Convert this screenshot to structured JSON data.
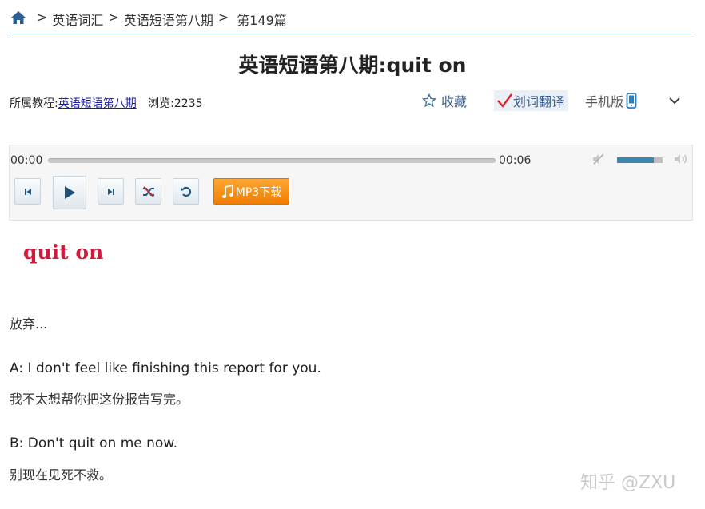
{
  "breadcrumb": {
    "items": [
      "英语词汇",
      "英语短语第八期",
      "第149篇"
    ],
    "separator": ">"
  },
  "title": "英语短语第八期:quit on",
  "meta": {
    "course_label": "所属教程:",
    "course_link": "英语短语第八期",
    "views_label": "浏览:",
    "views_count": "2235"
  },
  "toolbar": {
    "favorite": "收藏",
    "translate": "划词翻译",
    "mobile": "手机版"
  },
  "player": {
    "current_time": "00:00",
    "total_time": "00:06",
    "progress": 0,
    "volume": 0.8,
    "mp3_label": "MP3下载"
  },
  "content": {
    "headword": "quit on",
    "meaning": "放弃...",
    "dialog_a_en": "A: I don't feel like finishing this report for you.",
    "dialog_a_zh": "我不太想帮你把这份报告写完。",
    "dialog_b_en": "B: Don't quit on me now.",
    "dialog_b_zh": "别现在见死不救。"
  },
  "watermark": "知乎 @ZXU",
  "colors": {
    "accent_blue": "#3a5f8f",
    "headword_red": "#d01a3a",
    "mp3_orange": "#f08a10",
    "volume_blue": "#3b87ad"
  }
}
